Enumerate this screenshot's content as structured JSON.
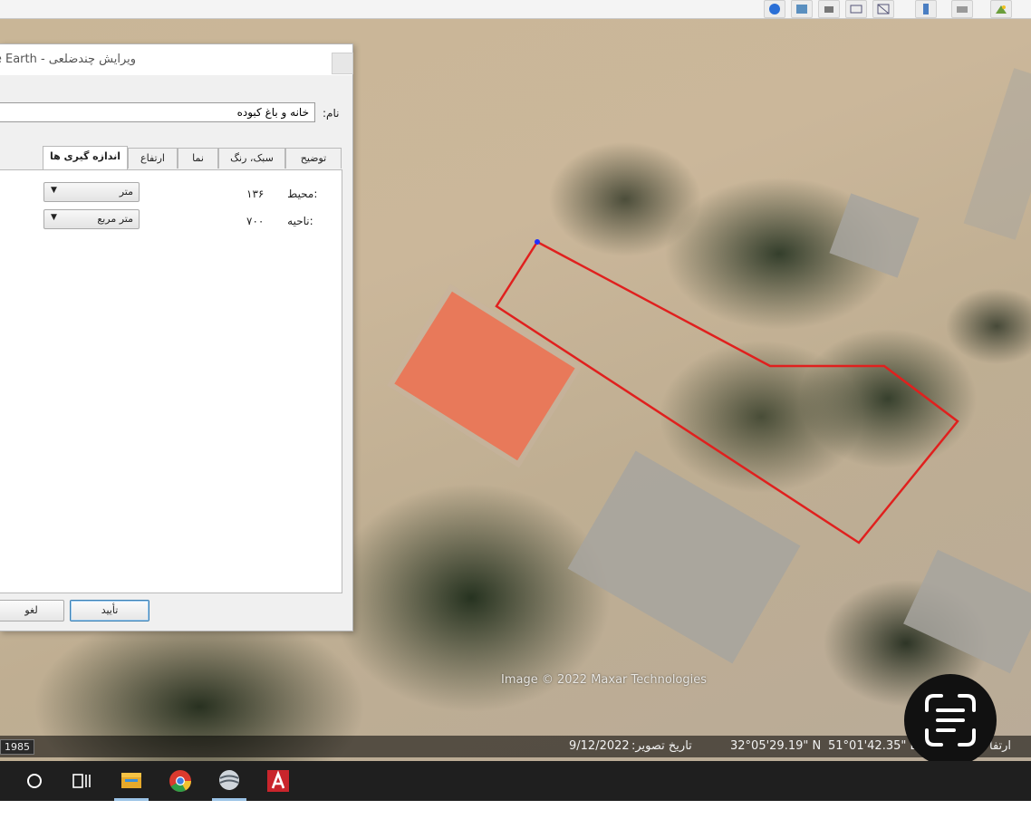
{
  "dialog": {
    "title": "ویرایش چندضلعی - Google Earth",
    "name_label": "نام:",
    "name_value": "خانه و باغ کبوده",
    "tabs": [
      {
        "label": "توضیح"
      },
      {
        "label": "سبک، رنگ"
      },
      {
        "label": "نما"
      },
      {
        "label": "ارتفاع"
      },
      {
        "label": "اندازه گیری ها",
        "active": true
      }
    ],
    "measurements": {
      "perimeter_label": "محیط:",
      "perimeter_value": "۱۳۶",
      "perimeter_unit": "متر",
      "area_label": "ناحیه:",
      "area_value": "۷۰۰",
      "area_unit": "متر مربع"
    },
    "ok_label": "تأیید",
    "cancel_label": "لغو"
  },
  "map": {
    "credit": "Image © 2022 Maxar Technologies",
    "polygon_color": "#e0201e",
    "roof_color": "#e8795a"
  },
  "statusbar": {
    "year": "1985",
    "image_date": "9/12/2022",
    "image_date_label": "تاریخ تصویر:",
    "latitude": "32°05'29.19\" N",
    "longitude": "51°01'42.35\" E",
    "elevation_label": "ارتفا"
  },
  "toolbar": {
    "icons": [
      "earth-icon",
      "sky-icon",
      "print-icon",
      "email-icon",
      "map-icon",
      "ruler-icon",
      "sun-icon",
      "planets-icon"
    ]
  },
  "taskbar": {
    "icons": [
      "cortana-circle-icon",
      "task-view-icon",
      "file-explorer-icon",
      "chrome-icon",
      "google-earth-icon",
      "autocad-icon"
    ]
  }
}
